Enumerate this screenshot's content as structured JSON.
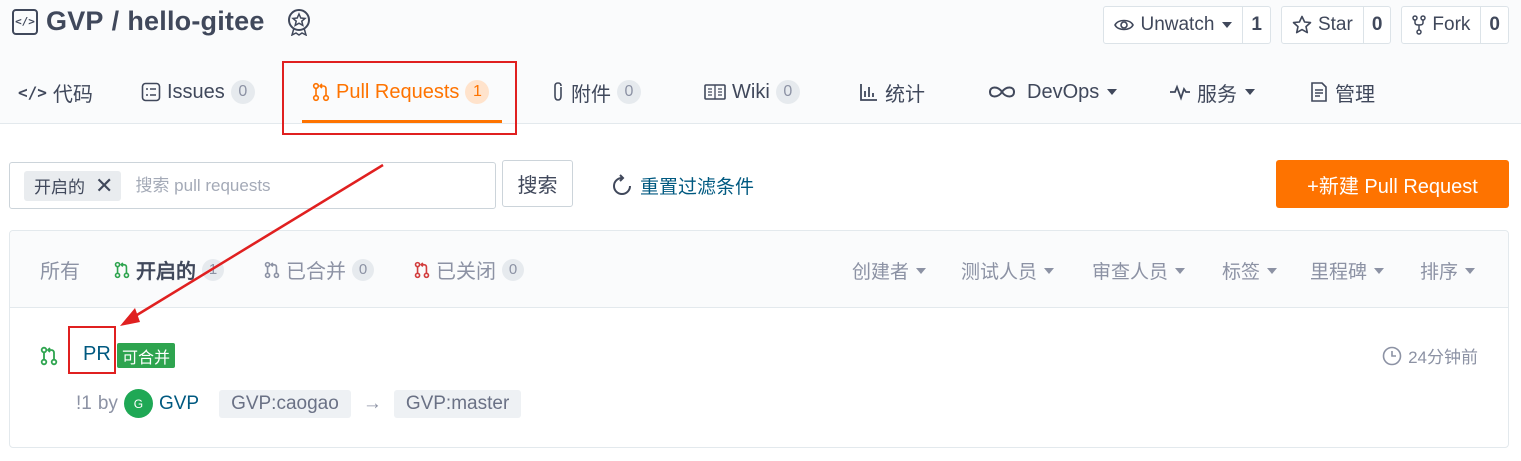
{
  "repo": {
    "owner": "GVP",
    "separator": "/",
    "name": "hello-gitee"
  },
  "actions": {
    "watch": {
      "label": "Unwatch",
      "count": "1"
    },
    "star": {
      "label": "Star",
      "count": "0"
    },
    "fork": {
      "label": "Fork",
      "count": "0"
    }
  },
  "tabs": [
    {
      "label": "代码",
      "count": null
    },
    {
      "label": "Issues",
      "count": "0"
    },
    {
      "label": "Pull Requests",
      "count": "1"
    },
    {
      "label": "附件",
      "count": "0"
    },
    {
      "label": "Wiki",
      "count": "0"
    },
    {
      "label": "统计",
      "count": null
    },
    {
      "label": "DevOps",
      "count": null
    },
    {
      "label": "服务",
      "count": null
    },
    {
      "label": "管理",
      "count": null
    }
  ],
  "filter": {
    "chip_label": "开启的",
    "search_placeholder": "搜索 pull requests",
    "search_button": "搜索",
    "reset_label": "重置过滤条件",
    "new_pr_label": "+新建 Pull Request"
  },
  "states": [
    {
      "label": "所有",
      "count": null
    },
    {
      "label": "开启的",
      "count": "1"
    },
    {
      "label": "已合并",
      "count": "0"
    },
    {
      "label": "已关闭",
      "count": "0"
    }
  ],
  "dropdowns": [
    "创建者",
    "测试人员",
    "审查人员",
    "标签",
    "里程碑",
    "排序"
  ],
  "pr": {
    "title": "PR",
    "status_badge": "可合并",
    "time": "24分钟前",
    "number": "!1",
    "by": "by",
    "avatar_letter": "G",
    "author": "GVP",
    "source_branch": "GVP:caogao",
    "arrow": "→",
    "target_branch": "GVP:master"
  },
  "colors": {
    "accent": "#fe7300",
    "link": "#005980",
    "success": "#2ea44f",
    "annotation": "#e02020"
  }
}
